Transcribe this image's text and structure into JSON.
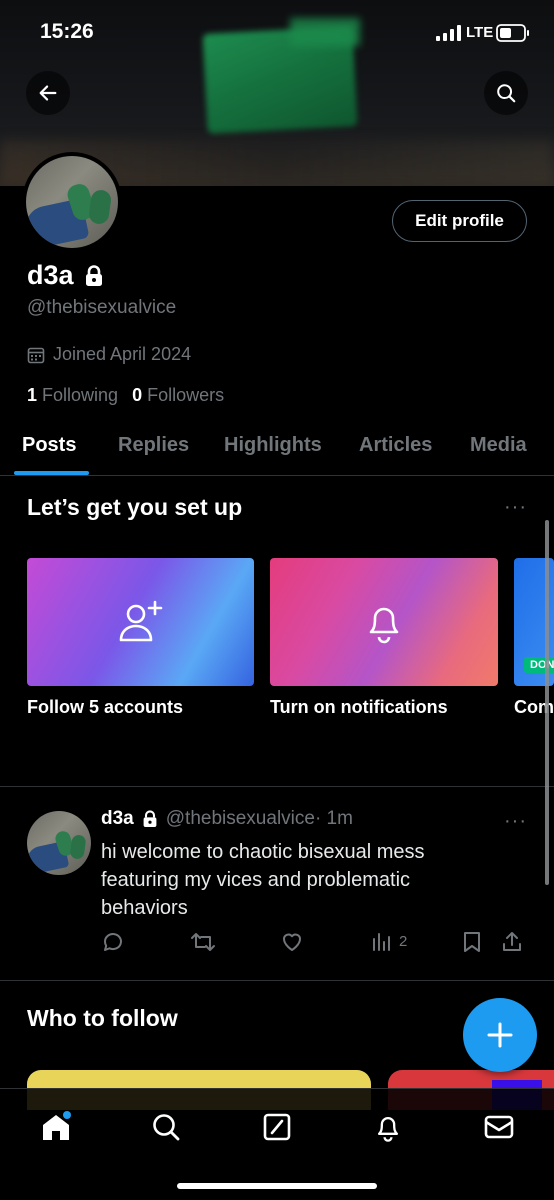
{
  "status_bar": {
    "time": "15:26",
    "network": "LTE"
  },
  "profile": {
    "display_name": "d3a",
    "handle": "@thebisexualvice",
    "joined": "Joined April 2024",
    "following_count": "1",
    "following_label": "Following",
    "followers_count": "0",
    "followers_label": "Followers",
    "edit_label": "Edit profile"
  },
  "tabs": [
    {
      "label": "Posts",
      "active": true
    },
    {
      "label": "Replies"
    },
    {
      "label": "Highlights"
    },
    {
      "label": "Articles"
    },
    {
      "label": "Media"
    }
  ],
  "setup": {
    "title": "Let’s get you set up",
    "cards": [
      {
        "label": "Follow 5 accounts",
        "icon": "add-user-icon"
      },
      {
        "label": "Turn on notifications",
        "icon": "bell-icon"
      },
      {
        "label": "Com",
        "badge": "DON"
      }
    ]
  },
  "tweet": {
    "name": "d3a",
    "handle": "@thebisexualvice",
    "time": "· 1m",
    "text": "hi welcome to chaotic bisexual mess featuring my vices and problematic behaviors",
    "views": "2"
  },
  "who_to_follow": {
    "title": "Who to follow"
  },
  "more_dots": "···",
  "colors": {
    "accent": "#1d9bf0",
    "background": "#000000",
    "muted": "#71767b"
  }
}
